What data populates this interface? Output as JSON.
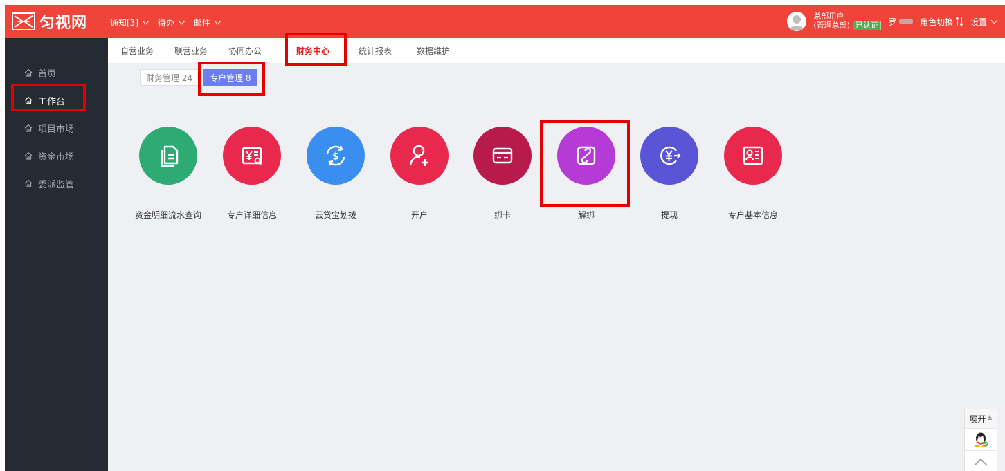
{
  "logo": {
    "text": "匀视网",
    "icon": "logo-mark-icon"
  },
  "topnav": [
    {
      "label": "通知[3]",
      "icon": "chevron-down-icon"
    },
    {
      "label": "待办",
      "icon": "chevron-down-icon"
    },
    {
      "label": "邮件",
      "icon": "chevron-down-icon"
    }
  ],
  "user": {
    "line1": "总部用户",
    "line2": "(管理总部)",
    "verified": "已认证",
    "name": "罗",
    "role_switch": "角色切换",
    "settings": "设置"
  },
  "sidebar": {
    "items": [
      {
        "label": "首页",
        "icon": "home-icon"
      },
      {
        "label": "工作台",
        "icon": "home-icon"
      },
      {
        "label": "项目市场",
        "icon": "home-icon"
      },
      {
        "label": "资金市场",
        "icon": "home-icon"
      },
      {
        "label": "委派监管",
        "icon": "home-icon"
      }
    ],
    "active_index": 1
  },
  "tabs": [
    "自营业务",
    "联营业务",
    "协同办公",
    "财务中心",
    "统计报表",
    "数据维护"
  ],
  "active_tab": "财务中心",
  "subtabs": [
    "财务管理 24",
    "专户管理 8"
  ],
  "active_subtab": "专户管理 8",
  "tiles": [
    {
      "label": "资金明细流水查询",
      "color": "#2eaa73",
      "icon": "document-list-icon"
    },
    {
      "label": "专户详细信息",
      "color": "#e8284d",
      "icon": "yuan-detail-icon"
    },
    {
      "label": "云贷宝划拨",
      "color": "#3a8ef0",
      "icon": "dollar-transfer-icon"
    },
    {
      "label": "开户",
      "color": "#e8284d",
      "icon": "add-user-icon"
    },
    {
      "label": "绑卡",
      "color": "#b81a4e",
      "icon": "card-icon"
    },
    {
      "label": "解绑",
      "color": "#b53ad6",
      "icon": "link-icon"
    },
    {
      "label": "提现",
      "color": "#5a54d6",
      "icon": "yuan-withdraw-icon"
    },
    {
      "label": "专户基本信息",
      "color": "#e8284d",
      "icon": "id-card-icon"
    }
  ],
  "float_panel": {
    "expand_label": "展开",
    "qq_icon": "qq-icon",
    "top_icon": "chevron-up-icon"
  },
  "colors": {
    "topbar": "#f0443a",
    "sidebar": "#262b33",
    "highlight": "#e50000",
    "subtab_active": "#6b7ef0",
    "tab_active_text": "#e02020"
  }
}
